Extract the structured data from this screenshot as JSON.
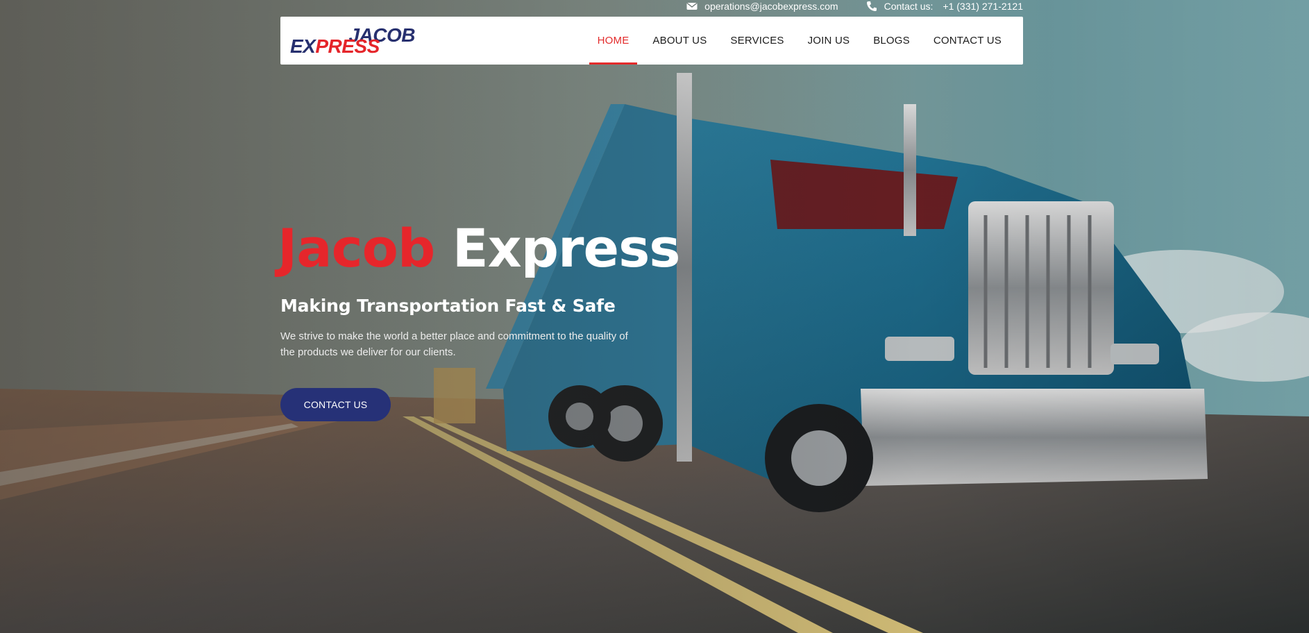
{
  "topbar": {
    "email": "operations@jacobexpress.com",
    "phone_label": "Contact us:",
    "phone": "+1 (331) 271-2121"
  },
  "logo": {
    "line1": "JACOB",
    "line2_part1": "EX",
    "line2_part2": "PRESS"
  },
  "nav": {
    "items": [
      {
        "label": "HOME",
        "active": true
      },
      {
        "label": "ABOUT US"
      },
      {
        "label": "SERVICES"
      },
      {
        "label": "JOIN US"
      },
      {
        "label": "BLOGS"
      },
      {
        "label": "CONTACT US"
      }
    ]
  },
  "hero": {
    "title_part1": "Jacob",
    "title_part2": "Express",
    "subtitle": "Making Transportation Fast & Safe",
    "description": "We strive to make the world a better place and commitment to the quality of the products we deliver for our clients.",
    "cta_label": "CONTACT US",
    "background_image": "blue-semi-truck-on-highway"
  },
  "colors": {
    "brand_red": "#e32b2b",
    "brand_navy": "#263177"
  }
}
